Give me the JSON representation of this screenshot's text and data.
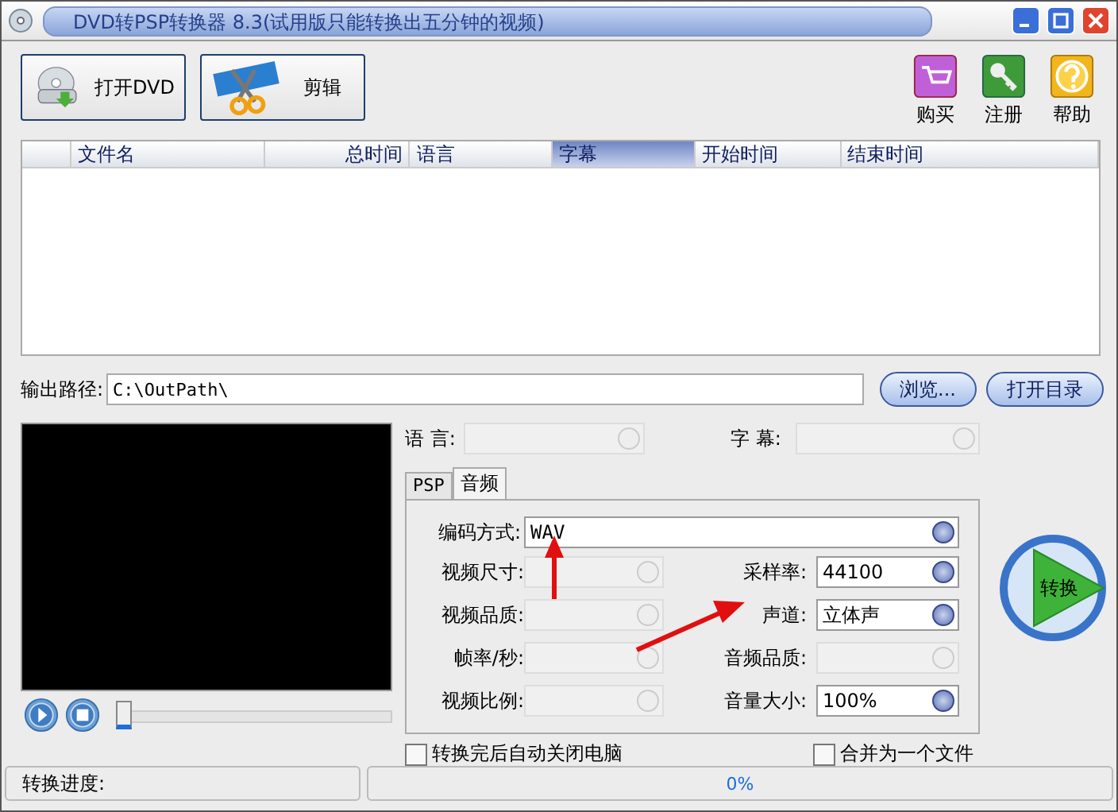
{
  "window": {
    "title": "DVD转PSP转换器 8.3(试用版只能转换出五分钟的视频)"
  },
  "toolbar": [
    {
      "label": "打开DVD",
      "kind": "dvd"
    },
    {
      "label": "剪辑",
      "kind": "clip"
    }
  ],
  "side_buttons": [
    {
      "label": "购买",
      "kind": "cart"
    },
    {
      "label": "注册",
      "kind": "key"
    },
    {
      "label": "帮助",
      "kind": "help"
    }
  ],
  "table": {
    "columns": [
      {
        "label": "文件名",
        "selected": false
      },
      {
        "label": "总时间",
        "selected": false
      },
      {
        "label": "语言",
        "selected": false
      },
      {
        "label": "字幕",
        "selected": true
      },
      {
        "label": "开始时间",
        "selected": false
      },
      {
        "label": "结束时间",
        "selected": false
      }
    ]
  },
  "output_path": {
    "label": "输出路径:",
    "value": "C:\\OutPath\\"
  },
  "path_buttons": [
    "浏览...",
    "打开目录"
  ],
  "player": {
    "level": 0
  },
  "language": {
    "label": "语 言:"
  },
  "subtitle": {
    "label": "字 幕:"
  },
  "tabs": [
    {
      "label": "PSP",
      "selected": false
    },
    {
      "label": "音频",
      "selected": true
    }
  ],
  "codec": {
    "label": "编码方式:",
    "value": "WAV"
  },
  "left_fields": [
    {
      "label": "视频尺寸:",
      "disabled": true
    },
    {
      "label": "视频品质:",
      "disabled": true
    },
    {
      "label": "帧率/秒:",
      "disabled": true
    },
    {
      "label": "视频比例:",
      "disabled": true
    }
  ],
  "right_fields": [
    {
      "label": "采样率:",
      "value": "44100",
      "disabled": false
    },
    {
      "label": "声道:",
      "value": "立体声",
      "disabled": false
    },
    {
      "label": "音频品质:",
      "disabled": true
    },
    {
      "label": "音量大小:",
      "value": "100%",
      "disabled": false
    }
  ],
  "convert_button": {
    "label": "转换"
  },
  "checkboxes": [
    {
      "label": "转换完后自动关闭电脑",
      "checked": false
    },
    {
      "label": "合并为一个文件",
      "checked": false
    }
  ],
  "status": {
    "label": "转换进度:",
    "progress": "0%"
  }
}
